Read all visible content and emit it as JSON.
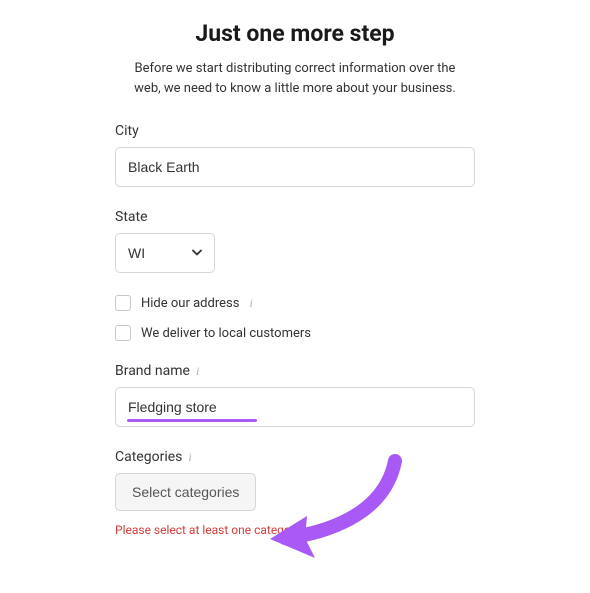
{
  "header": {
    "title": "Just one more step",
    "subtitle": "Before we start distributing correct information over the web, we need to know a little more about your business."
  },
  "form": {
    "city": {
      "label": "City",
      "value": "Black Earth"
    },
    "state": {
      "label": "State",
      "selected": "WI"
    },
    "checkboxes": {
      "hide_address": "Hide our address",
      "deliver_local": "We deliver to local customers"
    },
    "brand": {
      "label": "Brand name",
      "value": "Fledging store"
    },
    "categories": {
      "label": "Categories",
      "button": "Select categories",
      "error": "Please select at least one category."
    }
  },
  "colors": {
    "accent": "#a959f5",
    "error": "#d13c3c",
    "border": "#d6d6d6"
  }
}
